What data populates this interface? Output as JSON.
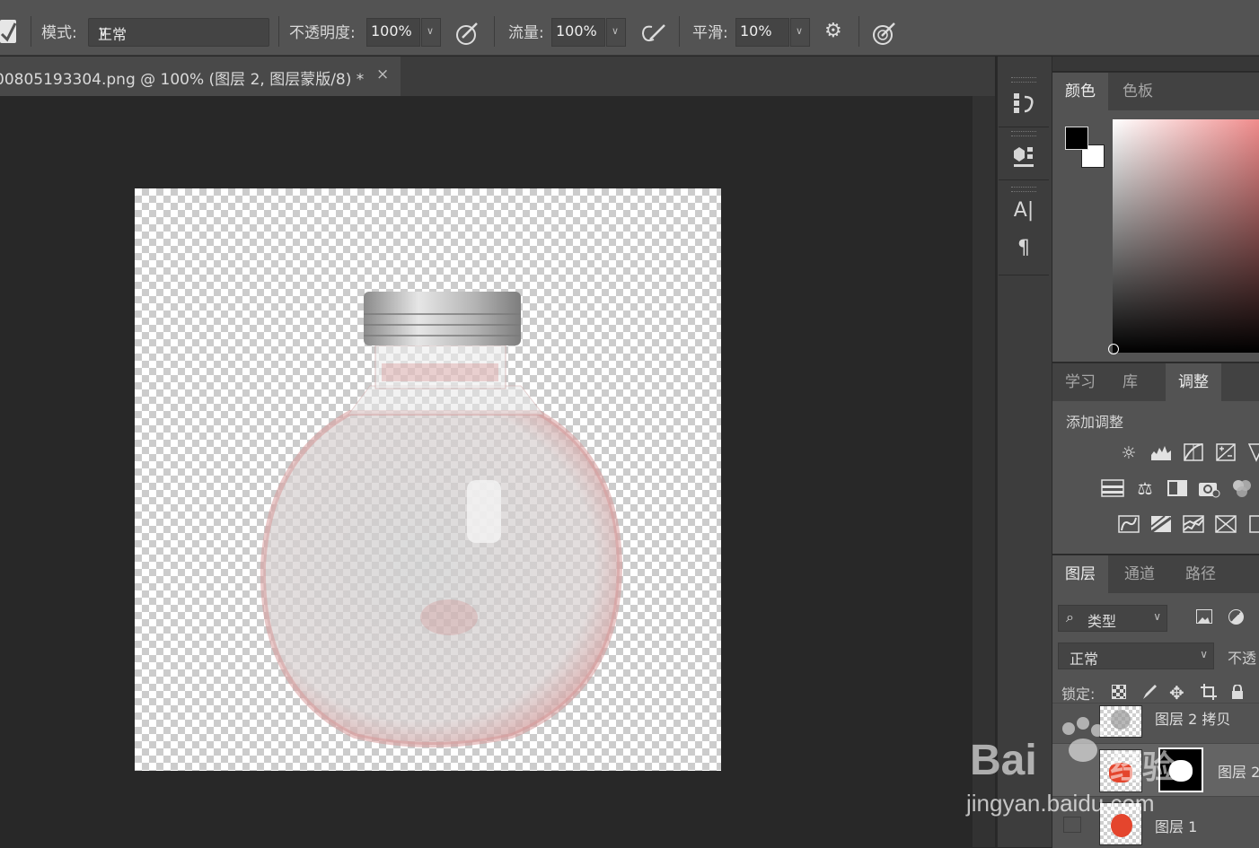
{
  "options_bar": {
    "mode_label": "模式:",
    "mode_value": "正常",
    "opacity_label": "不透明度:",
    "opacity_value": "100%",
    "flow_label": "流量:",
    "flow_value": "100%",
    "smooth_label": "平滑:",
    "smooth_value": "10%",
    "icons": [
      "brush-preset-icon",
      "pressure-opacity-icon",
      "airbrush-icon",
      "gear-icon",
      "pressure-size-icon"
    ]
  },
  "document": {
    "tab_title": "00805193304.png @ 100% (图层 2, 图层蒙版/8) *",
    "close_glyph": "×"
  },
  "mini_toolbar": {
    "collapse_glyph": "‹‹",
    "type_glyph": "A|",
    "paragraph_glyph": "¶"
  },
  "color_panel": {
    "tabs": [
      "颜色",
      "色板"
    ],
    "active_tab": 0,
    "foreground": "#000000",
    "background": "#ffffff",
    "hue_color": "#f08c8c"
  },
  "adjust_panel": {
    "tabs": [
      "学习",
      "库",
      "调整"
    ],
    "active_tab": 2,
    "title": "添加调整"
  },
  "layers_panel": {
    "tabs": [
      "图层",
      "通道",
      "路径"
    ],
    "active_tab": 0,
    "filter_label": "类型",
    "blend_mode": "正常",
    "opacity_label": "不透",
    "lock_label": "锁定:",
    "layers": [
      {
        "name": "图层 2 拷贝"
      },
      {
        "name": "图层 2"
      },
      {
        "name": "图层 1"
      }
    ]
  },
  "watermark": {
    "brand": "Bai",
    "brand_cn": "经验",
    "url": "jingyan.baidu.com"
  }
}
